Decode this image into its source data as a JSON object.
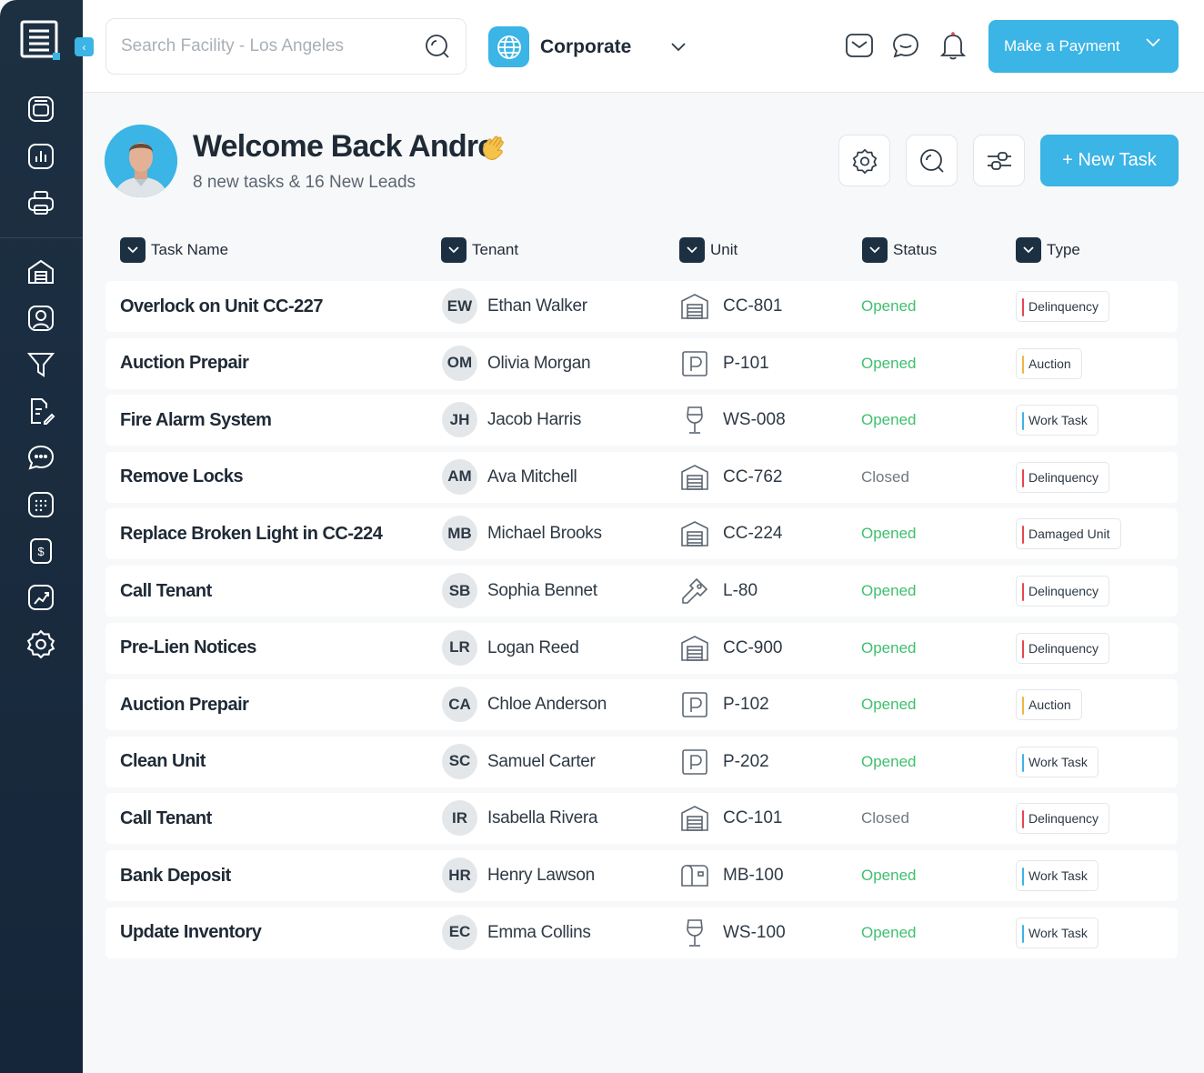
{
  "search": {
    "placeholder": "Search Facility - Los Angeles"
  },
  "org": {
    "name": "Corporate"
  },
  "payment_button": {
    "label": "Make a Payment"
  },
  "welcome": {
    "title": "Welcome Back Andre",
    "subtitle": "8 new tasks & 16 New Leads"
  },
  "new_task_button": {
    "label": "+ New Task"
  },
  "columns": [
    "Task Name",
    "Tenant",
    "Unit",
    "Status",
    "Type"
  ],
  "colors": {
    "accent": "#3bb4e6",
    "sidebar": "#1d3042",
    "opened": "#3fbf6f",
    "closed": "#6f7880",
    "delinquency": "#e5484d",
    "auction": "#f2b544",
    "work_task": "#3bb4e6",
    "damaged_unit": "#e5484d"
  },
  "tasks": [
    {
      "name": "Overlock on Unit CC-227",
      "initials": "EW",
      "tenant": "Ethan Walker",
      "unit_icon": "storage-unit-icon",
      "unit": "CC-801",
      "status": "Opened",
      "type": "Delinquency"
    },
    {
      "name": "Auction Prepair",
      "initials": "OM",
      "tenant": "Olivia Morgan",
      "unit_icon": "parking-icon",
      "unit": "P-101",
      "status": "Opened",
      "type": "Auction"
    },
    {
      "name": "Fire Alarm System",
      "initials": "JH",
      "tenant": "Jacob Harris",
      "unit_icon": "wine-icon",
      "unit": "WS-008",
      "status": "Opened",
      "type": "Work Task"
    },
    {
      "name": "Remove Locks",
      "initials": "AM",
      "tenant": "Ava Mitchell",
      "unit_icon": "storage-unit-icon",
      "unit": "CC-762",
      "status": "Closed",
      "type": "Delinquency"
    },
    {
      "name": "Replace Broken Light in CC-224",
      "initials": "MB",
      "tenant": "Michael Brooks",
      "unit_icon": "storage-unit-icon",
      "unit": "CC-224",
      "status": "Opened",
      "type": "Damaged Unit"
    },
    {
      "name": "Call Tenant",
      "initials": "SB",
      "tenant": "Sophia Bennet",
      "unit_icon": "locker-key-icon",
      "unit": "L-80",
      "status": "Opened",
      "type": "Delinquency"
    },
    {
      "name": "Pre-Lien Notices",
      "initials": "LR",
      "tenant": "Logan Reed",
      "unit_icon": "storage-unit-icon",
      "unit": "CC-900",
      "status": "Opened",
      "type": "Delinquency"
    },
    {
      "name": "Auction Prepair",
      "initials": "CA",
      "tenant": "Chloe Anderson",
      "unit_icon": "parking-icon",
      "unit": "P-102",
      "status": "Opened",
      "type": "Auction"
    },
    {
      "name": "Clean Unit",
      "initials": "SC",
      "tenant": "Samuel Carter",
      "unit_icon": "parking-icon",
      "unit": "P-202",
      "status": "Opened",
      "type": "Work Task"
    },
    {
      "name": "Call Tenant",
      "initials": "IR",
      "tenant": "Isabella Rivera",
      "unit_icon": "storage-unit-icon",
      "unit": "CC-101",
      "status": "Closed",
      "type": "Delinquency"
    },
    {
      "name": "Bank Deposit",
      "initials": "HR",
      "tenant": "Henry Lawson",
      "unit_icon": "mailbox-icon",
      "unit": "MB-100",
      "status": "Opened",
      "type": "Work Task"
    },
    {
      "name": "Update Inventory",
      "initials": "EC",
      "tenant": "Emma Collins",
      "unit_icon": "wine-icon",
      "unit": "WS-100",
      "status": "Opened",
      "type": "Work Task"
    }
  ]
}
